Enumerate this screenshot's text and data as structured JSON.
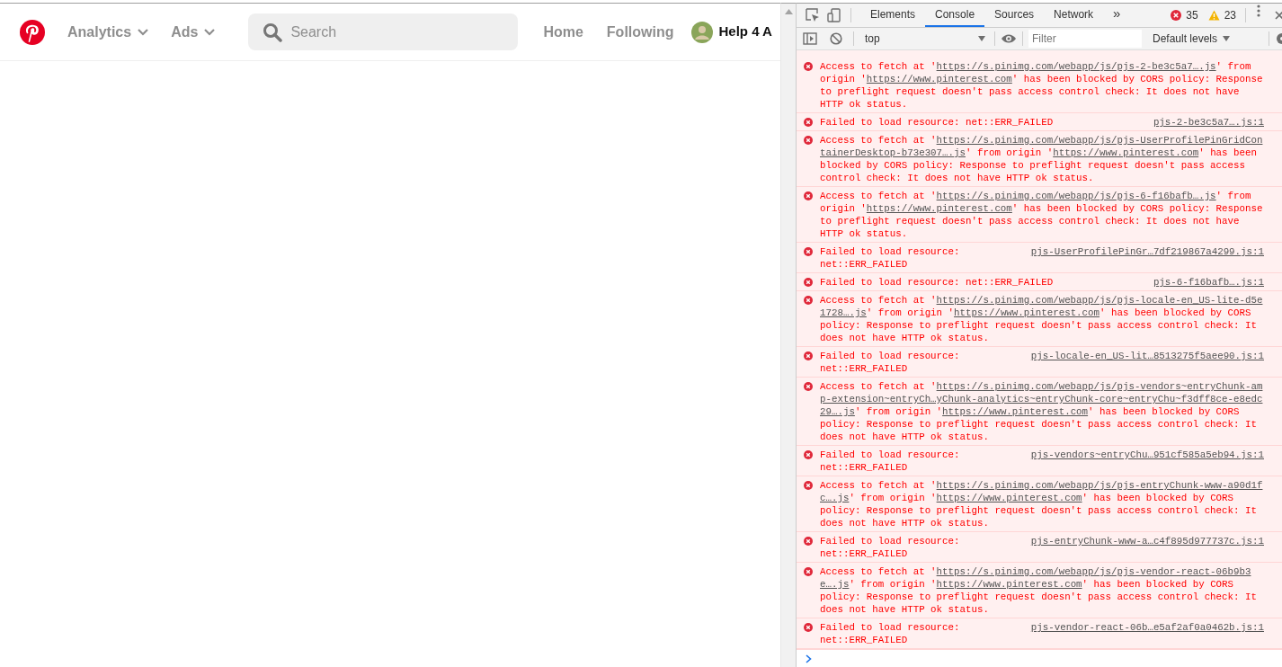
{
  "site": {
    "menus": [
      {
        "label": "Analytics"
      },
      {
        "label": "Ads"
      }
    ],
    "search": {
      "placeholder": "Search"
    },
    "links": [
      {
        "label": "Home"
      },
      {
        "label": "Following"
      }
    ],
    "profile": {
      "name": "Help 4 A"
    }
  },
  "devtools": {
    "tabs": [
      {
        "label": "Elements",
        "selected": false
      },
      {
        "label": "Console",
        "selected": true
      },
      {
        "label": "Sources",
        "selected": false
      },
      {
        "label": "Network",
        "selected": false
      }
    ],
    "more": "»",
    "errors": "35",
    "warnings": "23",
    "context": "top",
    "filter": {
      "placeholder": "Filter"
    },
    "levels": "Default levels",
    "messages": [
      {
        "kind": "cors",
        "parts": [
          {
            "text": "Access to fetch at '",
            "link": false
          },
          {
            "text": "https://s.pinimg.com/webapp/js/pjs-2-be3c5a7….js",
            "link": true
          },
          {
            "text": "' from origin '",
            "link": false
          },
          {
            "text": "https://www.pinterest.com",
            "link": true
          },
          {
            "text": "' has been blocked by CORS policy: Response to preflight request doesn't pass access control check: It does not have HTTP ok status.",
            "link": false
          }
        ]
      },
      {
        "kind": "failed",
        "text": "Failed to load resource: net::ERR_FAILED",
        "source": "pjs-2-be3c5a7….js:1"
      },
      {
        "kind": "cors",
        "parts": [
          {
            "text": "Access to fetch at '",
            "link": false
          },
          {
            "text": "https://s.pinimg.com/webapp/js/pjs-UserProfilePinGridContainerDesktop-b73e307….js",
            "link": true
          },
          {
            "text": "' from origin '",
            "link": false
          },
          {
            "text": "https://www.pinterest.com",
            "link": true
          },
          {
            "text": "' has been blocked by CORS policy: Response to preflight request doesn't pass access control check: It does not have HTTP ok status.",
            "link": false
          }
        ]
      },
      {
        "kind": "cors",
        "parts": [
          {
            "text": "Access to fetch at '",
            "link": false
          },
          {
            "text": "https://s.pinimg.com/webapp/js/pjs-6-f16bafb….js",
            "link": true
          },
          {
            "text": "' from origin '",
            "link": false
          },
          {
            "text": "https://www.pinterest.com",
            "link": true
          },
          {
            "text": "' has been blocked by CORS policy: Response to preflight request doesn't pass access control check: It does not have HTTP ok status.",
            "link": false
          }
        ]
      },
      {
        "kind": "failed",
        "text": "Failed to load resource: net::ERR_FAILED",
        "source": "pjs-UserProfilePinGr…7df219867a4299.js:1"
      },
      {
        "kind": "failed",
        "text": "Failed to load resource: net::ERR_FAILED",
        "source": "pjs-6-f16bafb….js:1"
      },
      {
        "kind": "cors",
        "parts": [
          {
            "text": "Access to fetch at '",
            "link": false
          },
          {
            "text": "https://s.pinimg.com/webapp/js/pjs-locale-en_US-lite-d5e1728….js",
            "link": true
          },
          {
            "text": "' from origin '",
            "link": false
          },
          {
            "text": "https://www.pinterest.com",
            "link": true
          },
          {
            "text": "' has been blocked by CORS policy: Response to preflight request doesn't pass access control check: It does not have HTTP ok status.",
            "link": false
          }
        ]
      },
      {
        "kind": "failed",
        "text": "Failed to load resource: net::ERR_FAILED",
        "source": "pjs-locale-en_US-lit…8513275f5aee90.js:1"
      },
      {
        "kind": "cors",
        "parts": [
          {
            "text": "Access to fetch at '",
            "link": false
          },
          {
            "text": "https://s.pinimg.com/webapp/js/pjs-vendors~entryChunk-amp-extension~entryCh…yChunk-analytics~entryChunk-core~entryChu~f3dff8ce-e8edc29….js",
            "link": true
          },
          {
            "text": "' from origin '",
            "link": false
          },
          {
            "text": "https://www.pinterest.com",
            "link": true
          },
          {
            "text": "' has been blocked by CORS policy: Response to preflight request doesn't pass access control check: It does not have HTTP ok status.",
            "link": false
          }
        ]
      },
      {
        "kind": "failed",
        "text": "Failed to load resource: net::ERR_FAILED",
        "source": "pjs-vendors~entryChu…951cf585a5eb94.js:1"
      },
      {
        "kind": "cors",
        "parts": [
          {
            "text": "Access to fetch at '",
            "link": false
          },
          {
            "text": "https://s.pinimg.com/webapp/js/pjs-entryChunk-www-a90d1fc….js",
            "link": true
          },
          {
            "text": "' from origin '",
            "link": false
          },
          {
            "text": "https://www.pinterest.com",
            "link": true
          },
          {
            "text": "' has been blocked by CORS policy: Response to preflight request doesn't pass access control check: It does not have HTTP ok status.",
            "link": false
          }
        ]
      },
      {
        "kind": "failed",
        "text": "Failed to load resource: net::ERR_FAILED",
        "source": "pjs-entryChunk-www-a…c4f895d977737c.js:1"
      },
      {
        "kind": "cors",
        "parts": [
          {
            "text": "Access to fetch at '",
            "link": false
          },
          {
            "text": "https://s.pinimg.com/webapp/js/pjs-vendor-react-06b9b3e….js",
            "link": true
          },
          {
            "text": "' from origin '",
            "link": false
          },
          {
            "text": "https://www.pinterest.com",
            "link": true
          },
          {
            "text": "' has been blocked by CORS policy: Response to preflight request doesn't pass access control check: It does not have HTTP ok status.",
            "link": false
          }
        ]
      },
      {
        "kind": "failed",
        "text": "Failed to load resource: net::ERR_FAILED",
        "source": "pjs-vendor-react-06b…e5af2af0a0462b.js:1"
      }
    ]
  }
}
